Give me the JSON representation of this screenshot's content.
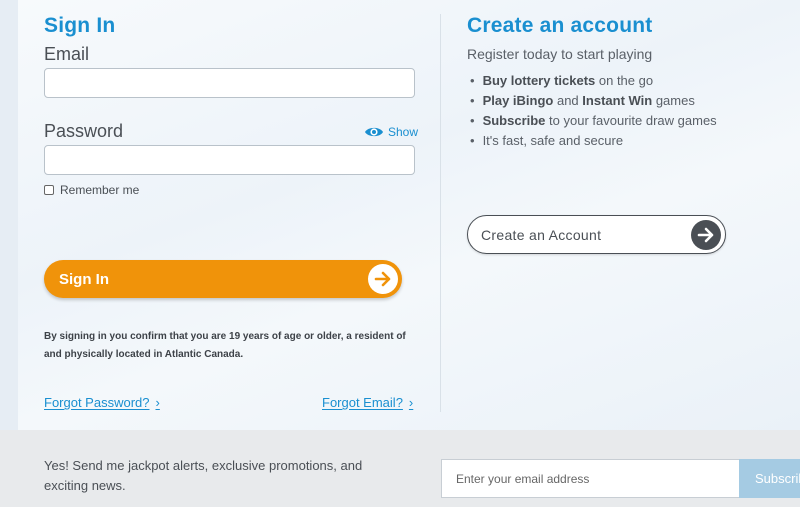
{
  "signin": {
    "title": "Sign In",
    "email_label": "Email",
    "email_value": "",
    "password_label": "Password",
    "password_value": "",
    "show_label": "Show",
    "remember_label": "Remember me",
    "remember_checked": false,
    "button_label": "Sign In",
    "fine_print": "By signing in you confirm that you are 19 years of age or older, a resident of and physically located in Atlantic Canada.",
    "forgot_password": "Forgot Password?",
    "forgot_email": "Forgot Email?"
  },
  "create": {
    "title": "Create an account",
    "subtitle": "Register today to start playing",
    "bullets": [
      {
        "bold": "Buy lottery tickets",
        "rest": " on the go"
      },
      {
        "bold": "Play iBingo",
        "mid": " and ",
        "bold2": "Instant Win",
        "rest": " games"
      },
      {
        "bold": "Subscribe",
        "rest": " to your favourite draw games"
      },
      {
        "bold": "",
        "rest": "It's fast, safe and secure"
      }
    ],
    "button_label": "Create an Account"
  },
  "footer": {
    "text": "Yes! Send me jackpot alerts, exclusive promotions, and exciting news.",
    "email_placeholder": "Enter your email address",
    "subscribe_label": "Subscribe"
  },
  "colors": {
    "accent_blue": "#1a8fd0",
    "orange": "#f0930a",
    "dark": "#4a4f55"
  },
  "icons": {
    "eye": "eye-icon",
    "arrow": "arrow-right-icon",
    "chevron": "chevron-right-icon"
  }
}
